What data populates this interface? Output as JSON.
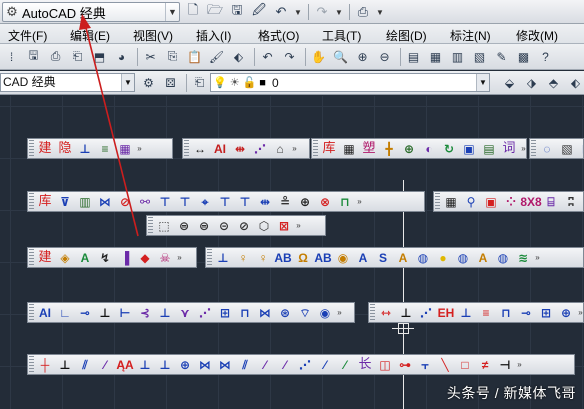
{
  "titlebar": {
    "workspace_label": "AutoCAD 经典",
    "workspace_icon": "gear-icon",
    "quick_access": [
      "new-icon",
      "open-icon",
      "save-icon",
      "save-as-icon",
      "undo-icon",
      "redo-icon",
      "plot-icon"
    ]
  },
  "menubar": {
    "items": [
      "文件(F)",
      "编辑(E)",
      "视图(V)",
      "插入(I)",
      "格式(O)",
      "工具(T)",
      "绘图(D)",
      "标注(N)",
      "修改(M)"
    ]
  },
  "workspace_combo": {
    "value": "CAD 经典"
  },
  "layer_combo": {
    "value": "0"
  },
  "toolbars": [
    {
      "name": "toolbar-architecture",
      "tools": [
        {
          "g": "建",
          "c": "#d42020",
          "k": "cjk"
        },
        {
          "g": "隐",
          "c": "#d42020",
          "k": "cjk"
        },
        {
          "g": "⊥",
          "c": "#1a3fb5"
        },
        {
          "g": "≡",
          "c": "#2a6b2a"
        },
        {
          "g": "▦",
          "c": "#6b2aa8"
        }
      ]
    },
    {
      "name": "toolbar-dimension-a",
      "tools": [
        {
          "g": "↔",
          "c": "#111"
        },
        {
          "g": "AI",
          "c": "#c41e1e"
        },
        {
          "g": "⇹",
          "c": "#c41e1e"
        },
        {
          "g": "⋰",
          "c": "#6b2aa8"
        },
        {
          "g": "⌂",
          "c": "#444"
        }
      ]
    },
    {
      "name": "toolbar-library",
      "tools": [
        {
          "g": "库",
          "c": "#d42020",
          "k": "cjk"
        },
        {
          "g": "▦",
          "c": "#222"
        },
        {
          "g": "塑",
          "c": "#b0186a",
          "k": "cjk"
        },
        {
          "g": "╋",
          "c": "#c47d00"
        },
        {
          "g": "⊕",
          "c": "#2a6b2a"
        },
        {
          "g": "◐",
          "c": "#6b2aa8"
        },
        {
          "g": "↻",
          "c": "#1a8a3a"
        },
        {
          "g": "▣",
          "c": "#1a3fb5"
        },
        {
          "g": "▤",
          "c": "#2a6b2a"
        },
        {
          "g": "词",
          "c": "#6b2aa8",
          "k": "cjk"
        }
      ]
    },
    {
      "name": "toolbar-misc-right",
      "tools": [
        {
          "g": "◌",
          "c": "#1a3fb5"
        },
        {
          "g": "▧",
          "c": "#333"
        },
        {
          "g": "⊡",
          "c": "#1a3fb5"
        },
        {
          "g": "❖",
          "c": "#d42020"
        }
      ]
    },
    {
      "name": "toolbar-library-2",
      "tools": [
        {
          "g": "库",
          "c": "#d42020",
          "k": "cjk"
        },
        {
          "g": "⊽",
          "c": "#1a3fb5"
        },
        {
          "g": "▥",
          "c": "#2a6b2a"
        },
        {
          "g": "⋈",
          "c": "#1a3fb5"
        },
        {
          "g": "⊘",
          "c": "#d42020"
        },
        {
          "g": "⚯",
          "c": "#6b2aa8"
        },
        {
          "g": "⊤",
          "c": "#1a3fb5"
        },
        {
          "g": "⊤",
          "c": "#1a3fb5"
        },
        {
          "g": "⌖",
          "c": "#1a3fb5"
        },
        {
          "g": "⊤",
          "c": "#1a3fb5"
        },
        {
          "g": "⊤",
          "c": "#1a3fb5"
        },
        {
          "g": "⇹",
          "c": "#1a3fb5"
        },
        {
          "g": "≗",
          "c": "#333"
        },
        {
          "g": "⊕",
          "c": "#222"
        },
        {
          "g": "⊗",
          "c": "#d42020"
        },
        {
          "g": "⊓",
          "c": "#1a8a3a"
        }
      ]
    },
    {
      "name": "toolbar-table",
      "tools": [
        {
          "g": "▦",
          "c": "#222"
        },
        {
          "g": "⚲",
          "c": "#1a3fb5"
        },
        {
          "g": "▣",
          "c": "#d42020"
        },
        {
          "g": "⁘",
          "c": "#b0186a"
        },
        {
          "g": "8X8",
          "c": "#b0186a"
        },
        {
          "g": "⌸",
          "c": "#6b2aa8"
        },
        {
          "g": "ʭ",
          "c": "#333"
        }
      ]
    },
    {
      "name": "toolbar-solids",
      "tools": [
        {
          "g": "⬚",
          "c": "#333"
        },
        {
          "g": "⊜",
          "c": "#333"
        },
        {
          "g": "⊜",
          "c": "#333"
        },
        {
          "g": "⊝",
          "c": "#333"
        },
        {
          "g": "⊘",
          "c": "#333"
        },
        {
          "g": "⬡",
          "c": "#333"
        },
        {
          "g": "⊠",
          "c": "#d42020"
        }
      ]
    },
    {
      "name": "toolbar-architecture-2",
      "tools": [
        {
          "g": "建",
          "c": "#d42020",
          "k": "cjk"
        },
        {
          "g": "◈",
          "c": "#c47d00"
        },
        {
          "g": "A",
          "c": "#1a8a3a"
        },
        {
          "g": "↯",
          "c": "#222"
        },
        {
          "g": "▐",
          "c": "#6b2aa8"
        },
        {
          "g": "◆",
          "c": "#d42020"
        },
        {
          "g": "☠",
          "c": "#b0186a"
        }
      ]
    },
    {
      "name": "toolbar-text-styles",
      "tools": [
        {
          "g": "⊥",
          "c": "#1a3fb5"
        },
        {
          "g": "♀",
          "c": "#c47d00"
        },
        {
          "g": "♀",
          "c": "#c47d00"
        },
        {
          "g": "AB",
          "c": "#1a3fb5"
        },
        {
          "g": "Ω",
          "c": "#c47d00"
        },
        {
          "g": "AB",
          "c": "#1a3fb5"
        },
        {
          "g": "◉",
          "c": "#c47d00"
        },
        {
          "g": "A",
          "c": "#1a3fb5"
        },
        {
          "g": "S",
          "c": "#1a3fb5"
        },
        {
          "g": "A",
          "c": "#c47d00"
        },
        {
          "g": "◍",
          "c": "#1a3fb5"
        },
        {
          "g": "●",
          "c": "#e0b800"
        },
        {
          "g": "◍",
          "c": "#1a3fb5"
        },
        {
          "g": "A",
          "c": "#c47d00"
        },
        {
          "g": "◍",
          "c": "#1a3fb5"
        },
        {
          "g": "≋",
          "c": "#1a8a3a"
        }
      ]
    },
    {
      "name": "toolbar-annotation",
      "tools": [
        {
          "g": "AI",
          "c": "#1a3fb5"
        },
        {
          "g": "∟",
          "c": "#1a3fb5"
        },
        {
          "g": "⊸",
          "c": "#1a3fb5"
        },
        {
          "g": "⊥",
          "c": "#111"
        },
        {
          "g": "⊢",
          "c": "#1a3fb5"
        },
        {
          "g": "⊰",
          "c": "#6b2aa8"
        },
        {
          "g": "⊥",
          "c": "#1a3fb5"
        },
        {
          "g": "⋎",
          "c": "#6b2aa8"
        },
        {
          "g": "⋰",
          "c": "#6b2aa8"
        },
        {
          "g": "⊞",
          "c": "#1a3fb5"
        },
        {
          "g": "⊓",
          "c": "#1a3fb5"
        },
        {
          "g": "⋈",
          "c": "#1a3fb5"
        },
        {
          "g": "⊛",
          "c": "#1a3fb5"
        },
        {
          "g": "⌔",
          "c": "#1a3fb5"
        },
        {
          "g": "◉",
          "c": "#1a3fb5"
        }
      ]
    },
    {
      "name": "toolbar-dimension-b",
      "tools": [
        {
          "g": "⇿",
          "c": "#d42020"
        },
        {
          "g": "⊥",
          "c": "#111"
        },
        {
          "g": "⋰",
          "c": "#1a3fb5"
        },
        {
          "g": "EH",
          "c": "#d42020"
        },
        {
          "g": "⊥",
          "c": "#1a3fb5"
        },
        {
          "g": "≡",
          "c": "#d42020"
        },
        {
          "g": "⊓",
          "c": "#1a3fb5"
        },
        {
          "g": "⊸",
          "c": "#1a3fb5"
        },
        {
          "g": "⊞",
          "c": "#1a3fb5"
        },
        {
          "g": "⊕",
          "c": "#1a3fb5"
        }
      ]
    },
    {
      "name": "toolbar-draw-bottom",
      "tools": [
        {
          "g": "┼",
          "c": "#d42020"
        },
        {
          "g": "⊥",
          "c": "#111"
        },
        {
          "g": "⫽",
          "c": "#1a3fb5"
        },
        {
          "g": "⁄",
          "c": "#6b2aa8"
        },
        {
          "g": "ĄA",
          "c": "#d42020"
        },
        {
          "g": "⊥",
          "c": "#1a3fb5"
        },
        {
          "g": "⊥",
          "c": "#1a3fb5"
        },
        {
          "g": "⊕",
          "c": "#1a3fb5"
        },
        {
          "g": "⋈",
          "c": "#1a3fb5"
        },
        {
          "g": "⋈",
          "c": "#1a3fb5"
        },
        {
          "g": "⫽",
          "c": "#1a3fb5"
        },
        {
          "g": "⁄",
          "c": "#6b2aa8"
        },
        {
          "g": "⁄",
          "c": "#6b2aa8"
        },
        {
          "g": "⋰",
          "c": "#1a3fb5"
        },
        {
          "g": "⁄",
          "c": "#1a3fb5"
        },
        {
          "g": "⁄",
          "c": "#1a8a3a"
        },
        {
          "g": "长",
          "c": "#6b2aa8",
          "k": "cjk"
        },
        {
          "g": "◫",
          "c": "#d42020"
        },
        {
          "g": "⊶",
          "c": "#d42020"
        },
        {
          "g": "⫟",
          "c": "#1a3fb5"
        },
        {
          "g": "╲",
          "c": "#d42020"
        },
        {
          "g": "□",
          "c": "#d42020"
        },
        {
          "g": "≠",
          "c": "#d42020"
        },
        {
          "g": "⊣",
          "c": "#111"
        }
      ]
    }
  ],
  "watermark": "头条号 / 新媒体飞哥",
  "colors": {
    "canvas": "#232c38",
    "annotation_arrow": "#cc1e1e"
  }
}
